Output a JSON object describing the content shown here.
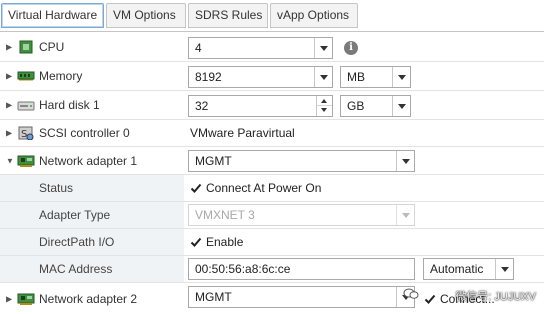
{
  "tabs": [
    {
      "label": "Virtual Hardware",
      "active": true
    },
    {
      "label": "VM Options",
      "active": false
    },
    {
      "label": "SDRS Rules",
      "active": false
    },
    {
      "label": "vApp Options",
      "active": false
    }
  ],
  "cpu": {
    "label": "CPU",
    "icon": "cpu-chip-icon",
    "value": "4",
    "info_glyph": "i"
  },
  "memory": {
    "label": "Memory",
    "icon": "memory-module-icon",
    "value": "8192",
    "unit": "MB"
  },
  "hard_disk": {
    "label": "Hard disk 1",
    "icon": "hard-disk-icon",
    "value": "32",
    "unit": "GB"
  },
  "scsi": {
    "label": "SCSI controller 0",
    "icon": "scsi-controller-icon",
    "value": "VMware Paravirtual"
  },
  "nic1": {
    "label": "Network adapter 1",
    "icon": "network-card-icon",
    "network": "MGMT",
    "status_label": "Status",
    "status_value": "Connect At Power On",
    "adapter_type_label": "Adapter Type",
    "adapter_type_value": "VMXNET 3",
    "directpath_label": "DirectPath I/O",
    "directpath_value": "Enable",
    "mac_label": "MAC Address",
    "mac_value": "00:50:56:a8:6c:ce",
    "mac_mode": "Automatic"
  },
  "nic2": {
    "label": "Network adapter 2",
    "icon": "network-card-icon",
    "network": "MGMT",
    "connect_label": "Connect..."
  },
  "watermark": "微信号: JUJUXV",
  "colors": {
    "active_tab_border": "#7aa9d6",
    "label_shade": "#f0f3f6",
    "chip_green": "#3f8f3f"
  }
}
